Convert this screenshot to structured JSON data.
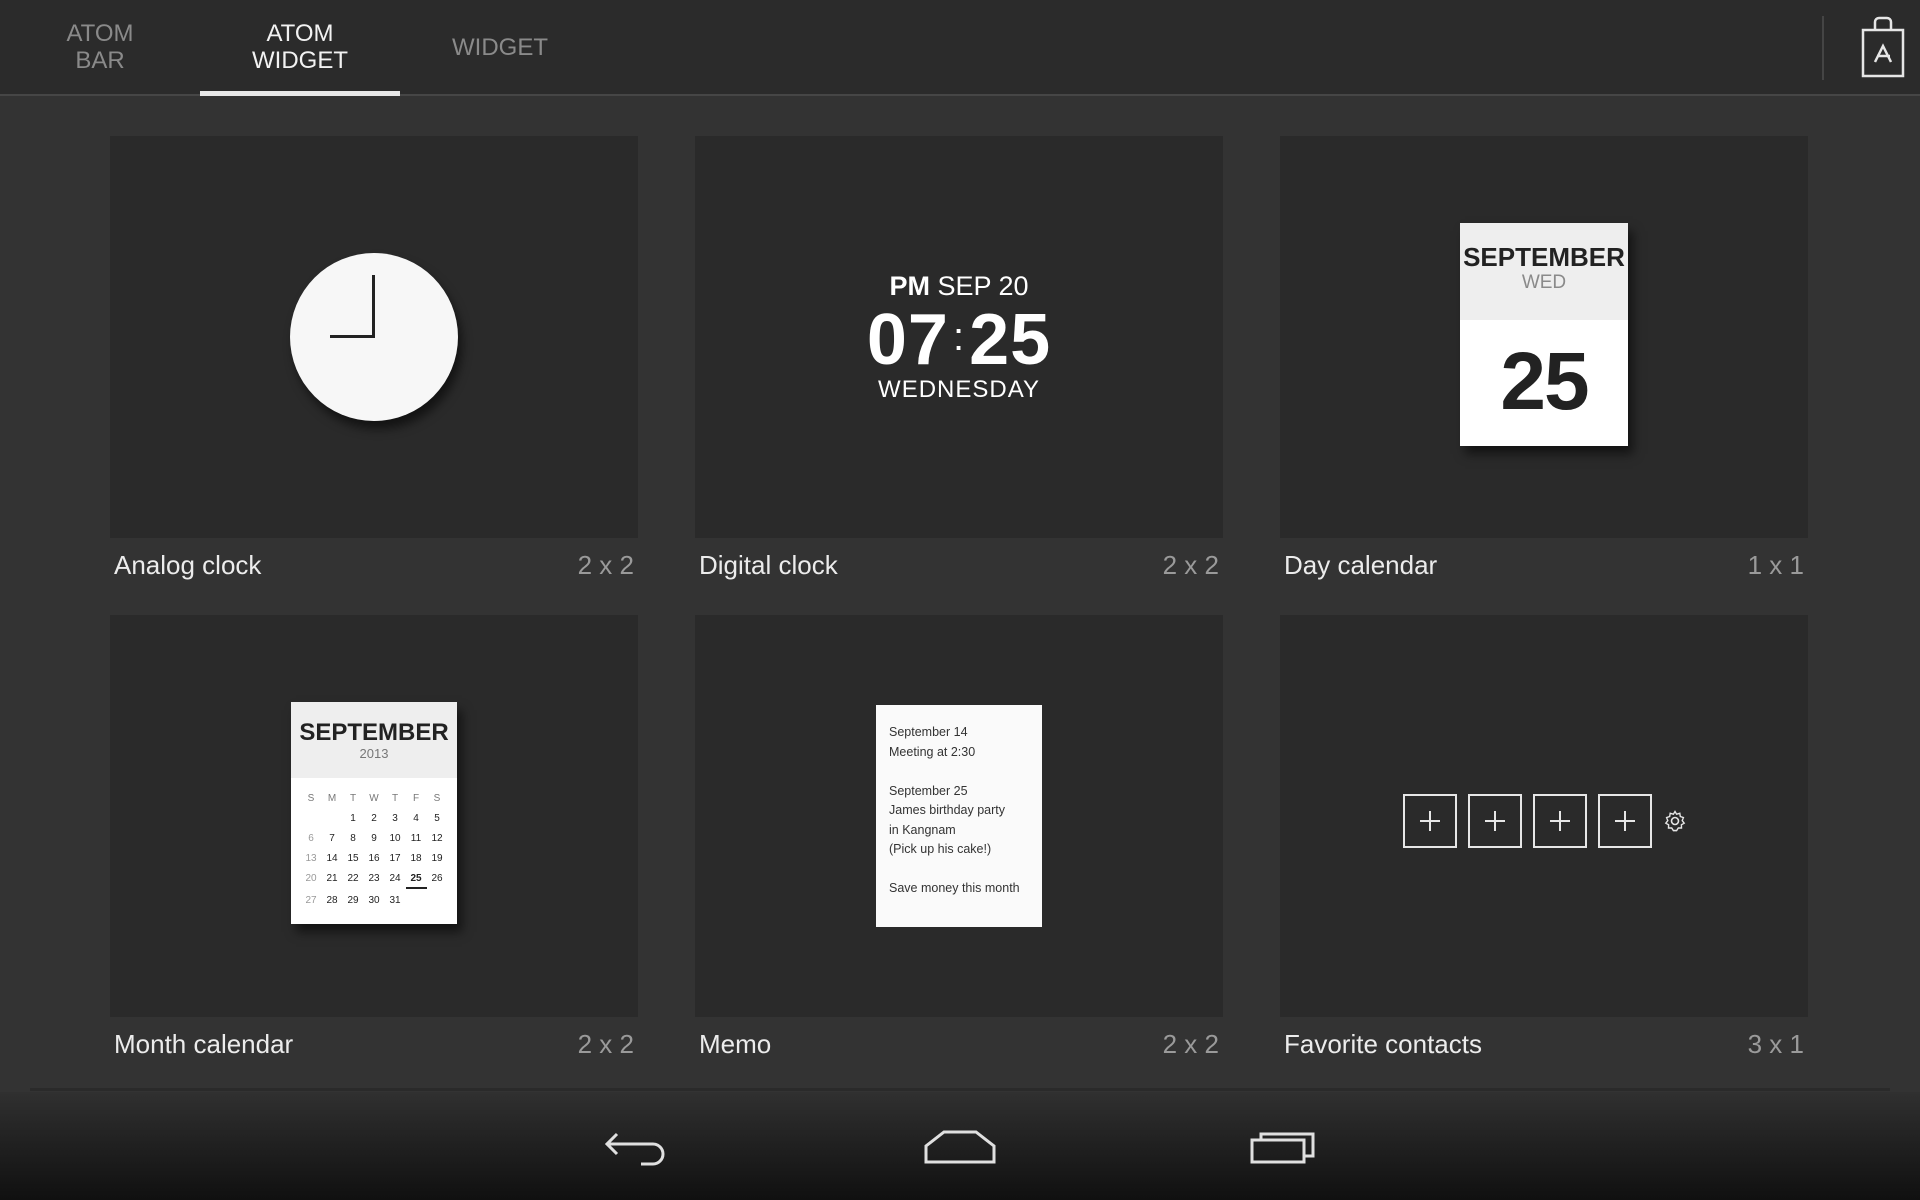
{
  "tabs": [
    {
      "line1": "ATOM",
      "line2": "BAR",
      "active": false
    },
    {
      "line1": "ATOM",
      "line2": "WIDGET",
      "active": true
    },
    {
      "line1": "WIDGET",
      "line2": "",
      "active": false
    }
  ],
  "store_icon": "shopping-bag-icon",
  "widgets": [
    {
      "name": "Analog clock",
      "size": "2 x 2"
    },
    {
      "name": "Digital clock",
      "size": "2 x 2"
    },
    {
      "name": "Day calendar",
      "size": "1 x 1"
    },
    {
      "name": "Month calendar",
      "size": "2 x 2"
    },
    {
      "name": "Memo",
      "size": "2 x 2"
    },
    {
      "name": "Favorite contacts",
      "size": "3 x 1"
    }
  ],
  "digital_clock": {
    "ampm": "PM",
    "date": "SEP 20",
    "hours": "07",
    "colon": ":",
    "minutes": "25",
    "day": "WEDNESDAY"
  },
  "day_calendar": {
    "month": "SEPTEMBER",
    "weekday": "WED",
    "day": "25"
  },
  "month_calendar": {
    "month": "SEPTEMBER",
    "year": "2013",
    "weekdays": [
      "S",
      "M",
      "T",
      "W",
      "T",
      "F",
      "S"
    ],
    "weeks": [
      [
        "",
        "",
        "1",
        "2",
        "3",
        "4",
        "5"
      ],
      [
        "6",
        "7",
        "8",
        "9",
        "10",
        "11",
        "12"
      ],
      [
        "13",
        "14",
        "15",
        "16",
        "17",
        "18",
        "19"
      ],
      [
        "20",
        "21",
        "22",
        "23",
        "24",
        "25",
        "26"
      ],
      [
        "27",
        "28",
        "29",
        "30",
        "31",
        "",
        ""
      ]
    ],
    "today": "25"
  },
  "memo": {
    "lines": [
      "September 14",
      "Meeting at 2:30",
      "",
      "September 25",
      "James birthday party",
      "in Kangnam",
      "(Pick up his cake!)",
      "",
      "Save money this month"
    ]
  },
  "contacts": {
    "slot_count": 4,
    "slot_icon": "plus-icon",
    "settings_icon": "gear-icon"
  },
  "nav": {
    "back_icon": "back-icon",
    "home_icon": "home-icon",
    "recents_icon": "recent-apps-icon"
  },
  "colors": {
    "background": "#333333",
    "card": "#2a2a2a",
    "topbar": "#2b2b2b",
    "accent": "#e8e8e8"
  }
}
